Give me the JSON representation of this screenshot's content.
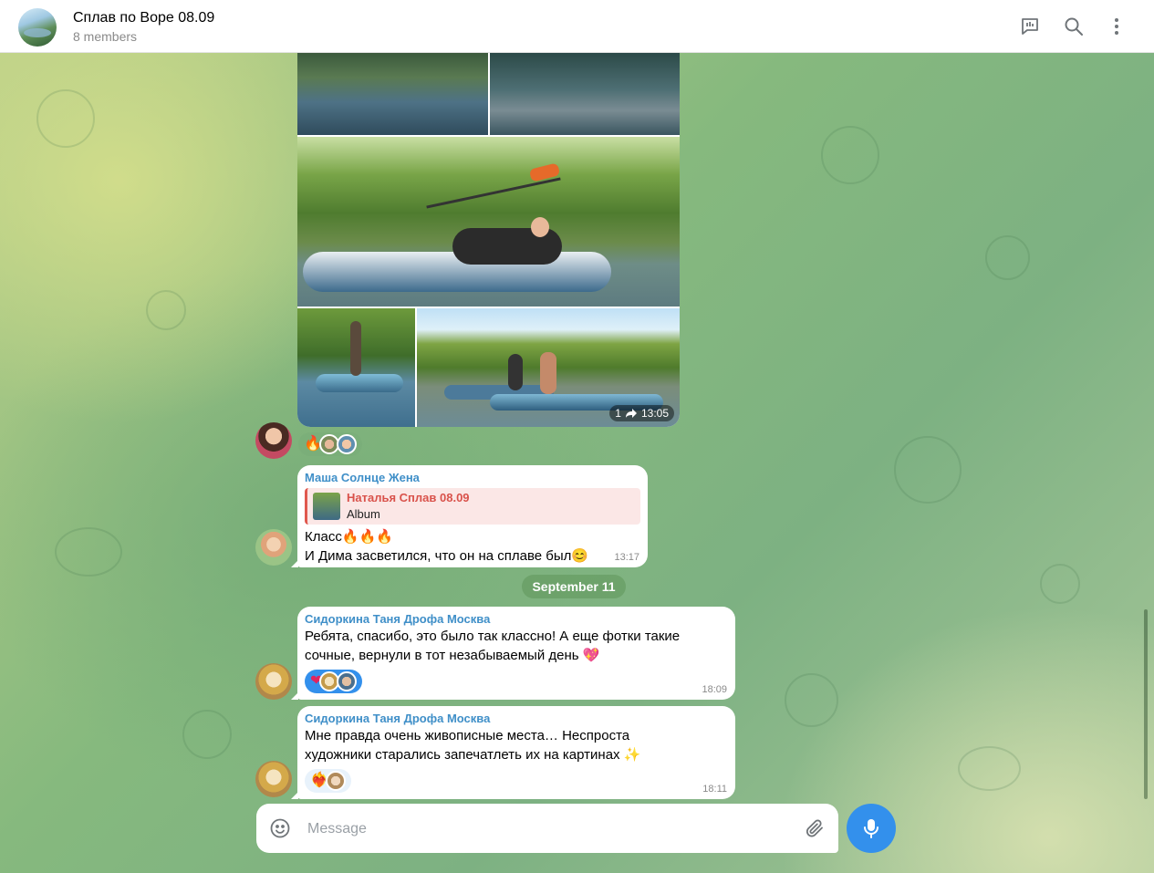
{
  "header": {
    "title": "Сплав по Воре 08.09",
    "subtitle": "8 members"
  },
  "album": {
    "views": "1",
    "time": "13:05",
    "reaction_emoji": "🔥"
  },
  "messages": [
    {
      "sender": "Маша Солнце Жена",
      "reply_name": "Наталья Сплав 08.09",
      "reply_text": "Album",
      "line1": "Класс🔥🔥🔥",
      "line2": "И Дима засветился, что он на сплаве был😊",
      "time": "13:17"
    },
    {
      "sender": "Сидоркина Таня Дрофа Москва",
      "line1": "Ребята, спасибо, это было так классно! А еще фотки такие",
      "line2": "сочные, вернули в тот незабываемый день 💖",
      "reaction_emoji": "❤",
      "time": "18:09"
    },
    {
      "sender": "Сидоркина Таня Дрофа Москва",
      "line1": "Мне правда очень живописные места… Неспроста",
      "line2": "художники старались запечатлеть их на картинах ✨",
      "reaction_emoji": "❤️‍🔥",
      "time": "18:11"
    }
  ],
  "date_separator": "September 11",
  "composer": {
    "placeholder": "Message"
  },
  "colors": {
    "accent": "#3390ec",
    "sender_blue": "#3f8fc8",
    "reply_red": "#d9524b"
  }
}
